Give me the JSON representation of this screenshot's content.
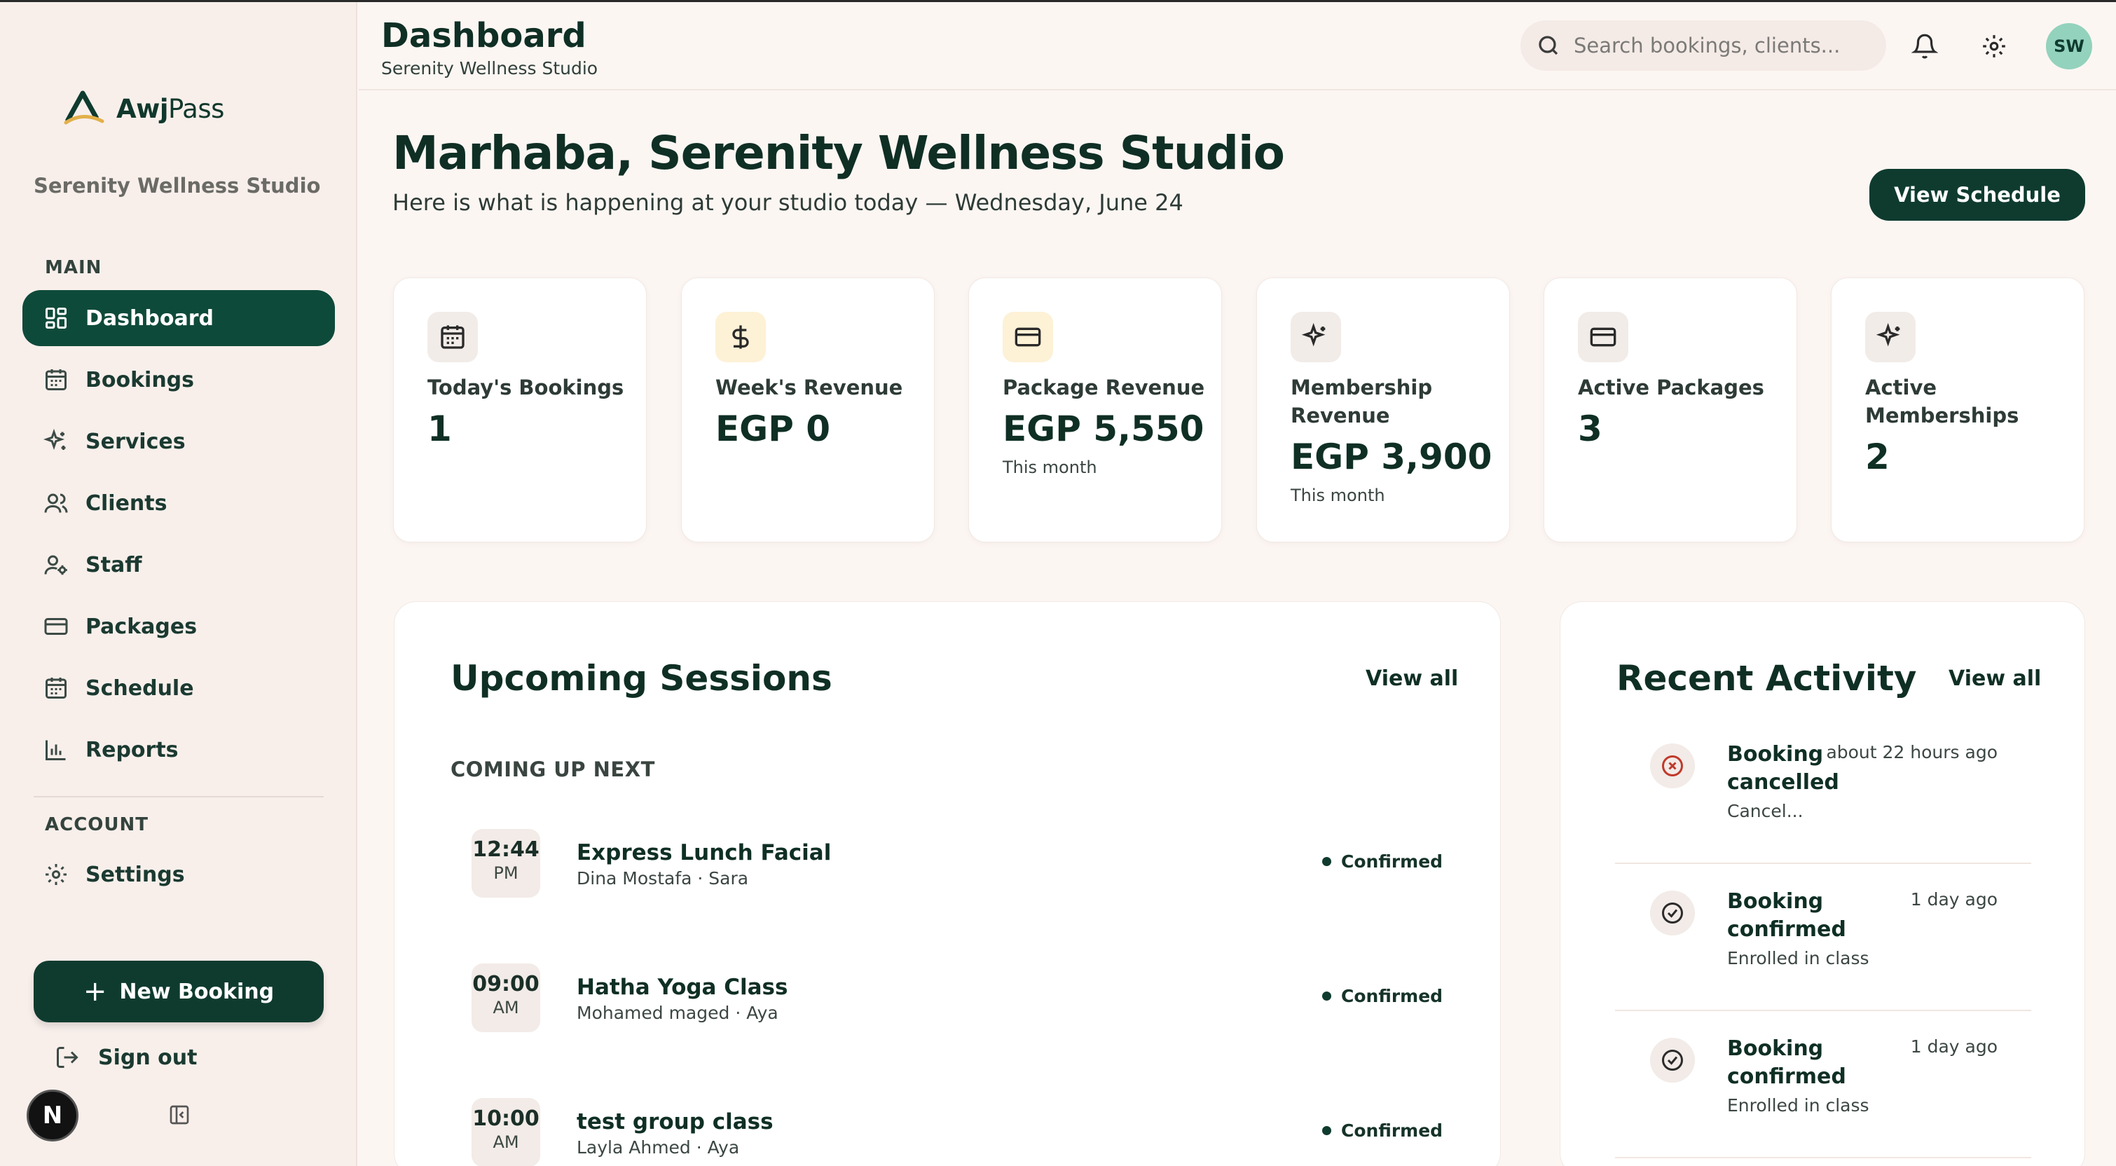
{
  "brand": {
    "logo_text_bold": "Awj",
    "logo_text_light": "Pass"
  },
  "sidebar": {
    "studio_name": "Serenity Wellness Studio",
    "main_label": "MAIN",
    "account_label": "ACCOUNT",
    "items": [
      {
        "label": "Dashboard",
        "icon": "dashboard-icon"
      },
      {
        "label": "Bookings",
        "icon": "calendar-icon"
      },
      {
        "label": "Services",
        "icon": "sparkles-icon"
      },
      {
        "label": "Clients",
        "icon": "users-icon"
      },
      {
        "label": "Staff",
        "icon": "user-cog-icon"
      },
      {
        "label": "Packages",
        "icon": "card-icon"
      },
      {
        "label": "Schedule",
        "icon": "calendar-icon"
      },
      {
        "label": "Reports",
        "icon": "bar-chart-icon"
      }
    ],
    "settings_label": "Settings",
    "new_booking_label": "New Booking",
    "signout_label": "Sign out",
    "user_initial": "N"
  },
  "header": {
    "title": "Dashboard",
    "subtitle": "Serenity Wellness Studio",
    "search_placeholder": "Search bookings, clients...",
    "avatar_initials": "SW"
  },
  "main": {
    "greeting": "Marhaba, Serenity Wellness Studio",
    "greeting_sub": "Here is what is happening at your studio today — Wednesday, June 24",
    "view_schedule_label": "View Schedule"
  },
  "stats": [
    {
      "label": "Today's Bookings",
      "value": "1",
      "note": "",
      "icon": "calendar-icon"
    },
    {
      "label": "Week's Revenue",
      "value": "EGP 0",
      "note": "",
      "icon": "dollar-icon"
    },
    {
      "label": "Package Revenue",
      "value": "EGP 5,550",
      "note": "This month",
      "icon": "card-icon"
    },
    {
      "label": "Membership Revenue",
      "value": "EGP 3,900",
      "note": "This month",
      "icon": "sparkles-icon"
    },
    {
      "label": "Active Packages",
      "value": "3",
      "note": "",
      "icon": "card-icon"
    },
    {
      "label": "Active Memberships",
      "value": "2",
      "note": "",
      "icon": "sparkles-icon"
    }
  ],
  "upcoming": {
    "title": "Upcoming Sessions",
    "view_all": "View all",
    "coming_up_label": "COMING UP NEXT",
    "sessions": [
      {
        "time": "12:44",
        "ampm": "PM",
        "name": "Express Lunch Facial",
        "meta": "Dina Mostafa · Sara",
        "status": "Confirmed"
      },
      {
        "time": "09:00",
        "ampm": "AM",
        "name": "Hatha Yoga Class",
        "meta": "Mohamed maged · Aya",
        "status": "Confirmed"
      },
      {
        "time": "10:00",
        "ampm": "AM",
        "name": "test group class",
        "meta": "Layla Ahmed · Aya",
        "status": "Confirmed"
      }
    ]
  },
  "activity": {
    "title": "Recent Activity",
    "view_all": "View all",
    "items": [
      {
        "title": "Booking cancelled",
        "time": "about 22 hours ago",
        "desc": "Cancel...",
        "icon": "x-circle-icon",
        "color": "#c0392b"
      },
      {
        "title": "Booking confirmed",
        "time": "1 day ago",
        "desc": "Enrolled in class",
        "icon": "check-circle-icon",
        "color": "#2b2b2b"
      },
      {
        "title": "Booking confirmed",
        "time": "1 day ago",
        "desc": "Enrolled in class",
        "icon": "check-circle-icon",
        "color": "#2b2b2b"
      }
    ]
  },
  "colors": {
    "primary": "#0f3b2f",
    "background": "#fcf6f3",
    "sidebar": "#f8efeb",
    "avatar": "#93d2bd"
  }
}
